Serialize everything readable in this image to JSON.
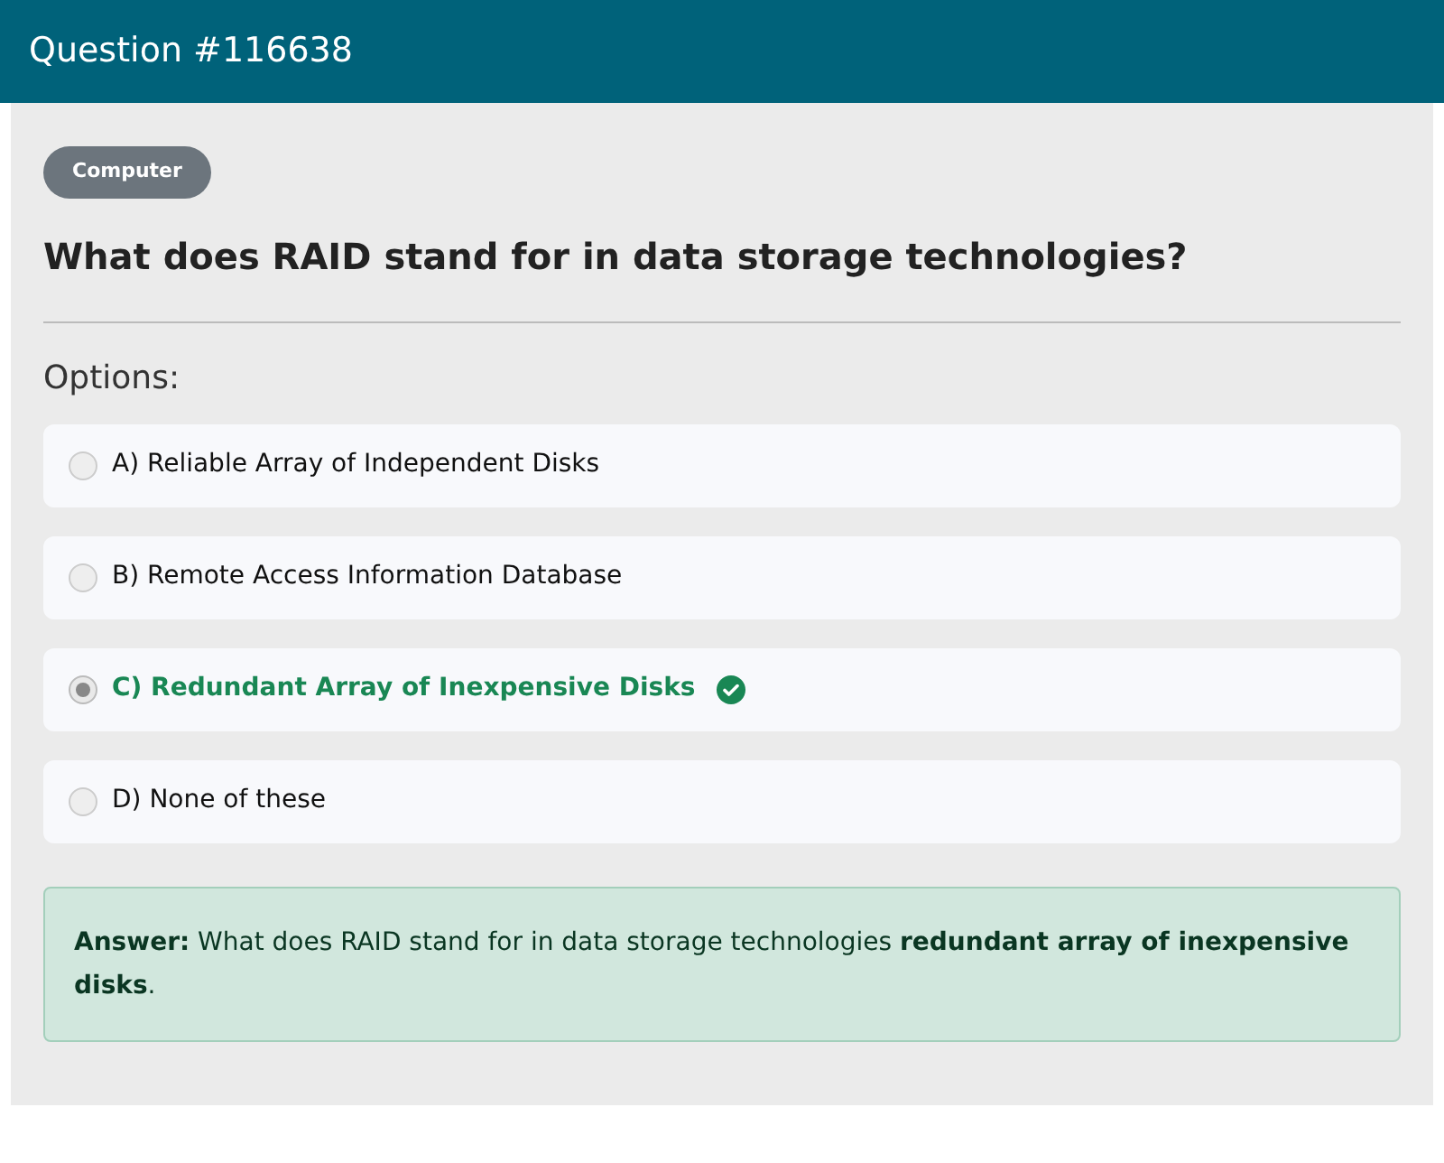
{
  "header": {
    "title": "Question #116638"
  },
  "category": "Computer",
  "question": "What does RAID stand for in data storage technologies?",
  "options_label": "Options:",
  "options": [
    {
      "label": "A) Reliable Array of Independent Disks",
      "selected": false,
      "correct": false
    },
    {
      "label": "B) Remote Access Information Database",
      "selected": false,
      "correct": false
    },
    {
      "label": "C) Redundant Array of Inexpensive Disks",
      "selected": true,
      "correct": true
    },
    {
      "label": "D) None of these",
      "selected": false,
      "correct": false
    }
  ],
  "answer": "**Answer:** What does RAID stand for in data storage technologies **redundant array of inexpensive disks**."
}
